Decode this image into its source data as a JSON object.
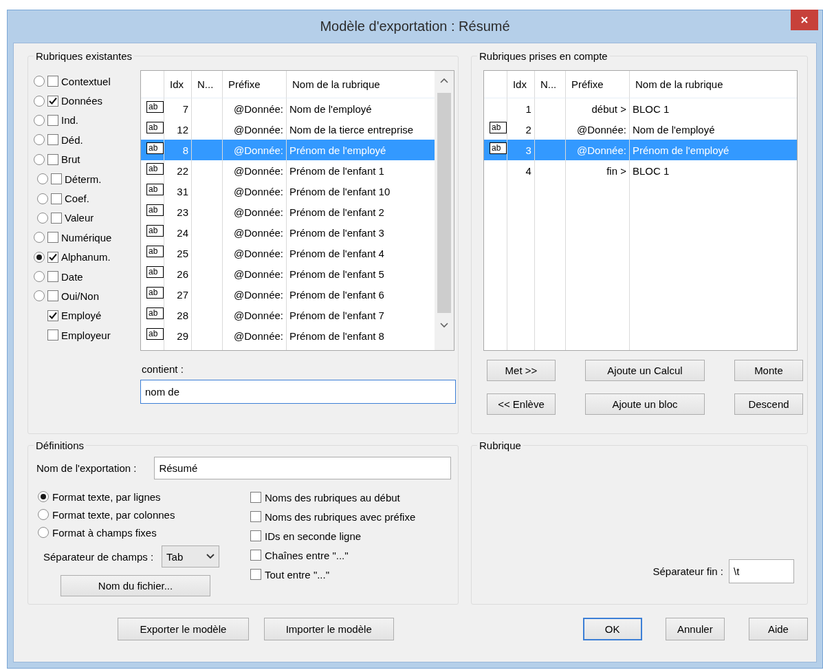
{
  "window": {
    "title": "Modèle d'exportation : Résumé"
  },
  "existing": {
    "title": "Rubriques existantes",
    "filters": [
      {
        "kind": "radio-check",
        "label": "Contextuel",
        "selected": false,
        "checked": false
      },
      {
        "kind": "radio-check",
        "label": "Données",
        "selected": false,
        "checked": true
      },
      {
        "kind": "radio-check",
        "label": "Ind.",
        "selected": false,
        "checked": false
      },
      {
        "kind": "radio-check",
        "label": "Déd.",
        "selected": false,
        "checked": false
      },
      {
        "kind": "radio-check",
        "label": "Brut",
        "selected": false,
        "checked": false,
        "children": [
          {
            "kind": "radio-check",
            "label": "Déterm.",
            "selected": false,
            "checked": false
          },
          {
            "kind": "radio-check",
            "label": "Coef.",
            "selected": false,
            "checked": false
          },
          {
            "kind": "radio-check",
            "label": "Valeur",
            "selected": false,
            "checked": false
          }
        ]
      },
      {
        "kind": "radio-check",
        "label": "Numérique",
        "selected": false,
        "checked": false
      },
      {
        "kind": "radio-check",
        "label": "Alphanum.",
        "selected": true,
        "checked": true
      },
      {
        "kind": "radio-check",
        "label": "Date",
        "selected": false,
        "checked": false
      },
      {
        "kind": "radio-check",
        "label": "Oui/Non",
        "selected": false,
        "checked": false
      },
      {
        "kind": "check",
        "label": "Employé",
        "checked": true
      },
      {
        "kind": "check",
        "label": "Employeur",
        "checked": false
      }
    ],
    "table": {
      "columns": [
        "Idx",
        "N...",
        "Préfixe",
        "Nom de la rubrique"
      ],
      "rows": [
        {
          "type": "ab",
          "idx": "7",
          "prefix": "@Donnée:",
          "name": "Nom de l'employé",
          "selected": false
        },
        {
          "type": "ab",
          "idx": "12",
          "prefix": "@Donnée:",
          "name": "Nom de la tierce entreprise",
          "selected": false
        },
        {
          "type": "ab",
          "idx": "8",
          "prefix": "@Donnée:",
          "name": "Prénom de l'employé",
          "selected": true
        },
        {
          "type": "ab",
          "idx": "22",
          "prefix": "@Donnée:",
          "name": "Prénom de l'enfant 1",
          "selected": false
        },
        {
          "type": "ab",
          "idx": "31",
          "prefix": "@Donnée:",
          "name": "Prénom de l'enfant 10",
          "selected": false
        },
        {
          "type": "ab",
          "idx": "23",
          "prefix": "@Donnée:",
          "name": "Prénom de l'enfant 2",
          "selected": false
        },
        {
          "type": "ab",
          "idx": "24",
          "prefix": "@Donnée:",
          "name": "Prénom de l'enfant 3",
          "selected": false
        },
        {
          "type": "ab",
          "idx": "25",
          "prefix": "@Donnée:",
          "name": "Prénom de l'enfant 4",
          "selected": false
        },
        {
          "type": "ab",
          "idx": "26",
          "prefix": "@Donnée:",
          "name": "Prénom de l'enfant 5",
          "selected": false
        },
        {
          "type": "ab",
          "idx": "27",
          "prefix": "@Donnée:",
          "name": "Prénom de l'enfant 6",
          "selected": false
        },
        {
          "type": "ab",
          "idx": "28",
          "prefix": "@Donnée:",
          "name": "Prénom de l'enfant 7",
          "selected": false
        },
        {
          "type": "ab",
          "idx": "29",
          "prefix": "@Donnée:",
          "name": "Prénom de l'enfant 8",
          "selected": false
        }
      ]
    },
    "search": {
      "label": "contient :",
      "value": "nom de"
    }
  },
  "included": {
    "title": "Rubriques prises en compte",
    "table": {
      "columns": [
        "Idx",
        "N...",
        "Préfixe",
        "Nom de la rubrique"
      ],
      "rows": [
        {
          "idx": "1",
          "prefix": "début >",
          "name": "BLOC 1",
          "selected": false
        },
        {
          "type": "ab",
          "idx": "2",
          "prefix": "@Donnée:",
          "name": "Nom de l'employé",
          "selected": false
        },
        {
          "type": "ab",
          "idx": "3",
          "prefix": "@Donnée:",
          "name": "Prénom de l'employé",
          "selected": true
        },
        {
          "idx": "4",
          "prefix": "fin >",
          "name": "BLOC 1",
          "selected": false
        }
      ]
    },
    "buttons": [
      "Met >>",
      "Ajoute un Calcul",
      "Monte",
      "<< Enlève",
      "Ajoute un bloc",
      "Descend"
    ]
  },
  "definitions": {
    "title": "Définitions",
    "export_name": {
      "label": "Nom de l'exportation :",
      "value": "Résumé"
    },
    "formats": [
      {
        "label": "Format texte, par lignes",
        "selected": true
      },
      {
        "label": "Format texte, par colonnes",
        "selected": false
      },
      {
        "label": "Format à champs fixes",
        "selected": false
      }
    ],
    "separator": {
      "label": "Séparateur de champs :",
      "value": "Tab"
    },
    "file_button": "Nom du fichier...",
    "options": [
      {
        "label": "Noms des rubriques au début",
        "checked": false
      },
      {
        "label": "Noms des rubriques avec préfixe",
        "checked": false
      },
      {
        "label": "IDs en seconde ligne",
        "checked": false
      },
      {
        "label": "Chaînes entre \"...\"",
        "checked": false
      },
      {
        "label": "Tout entre \"...\"",
        "checked": false
      }
    ]
  },
  "rubrique": {
    "title": "Rubrique",
    "end_separator": {
      "label": "Séparateur fin :",
      "value": "\\t"
    }
  },
  "buttons": [
    {
      "label": "Exporter le modèle",
      "default": false
    },
    {
      "label": "Importer le modèle",
      "default": false
    },
    {
      "label": "OK",
      "default": true
    },
    {
      "label": "Annuler",
      "default": false
    },
    {
      "label": "Aide",
      "default": false
    }
  ]
}
